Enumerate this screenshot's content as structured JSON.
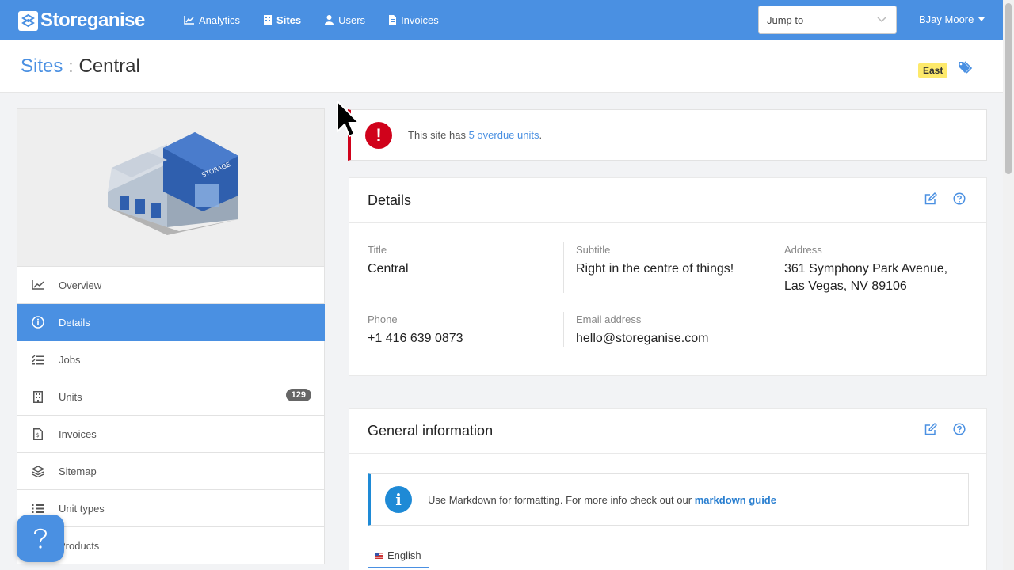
{
  "brand": {
    "name": "Storeganise"
  },
  "nav": {
    "items": [
      {
        "label": "Analytics",
        "icon": "chart-icon"
      },
      {
        "label": "Sites",
        "icon": "building-icon",
        "active": true
      },
      {
        "label": "Users",
        "icon": "user-icon"
      },
      {
        "label": "Invoices",
        "icon": "invoice-icon"
      }
    ],
    "jump_placeholder": "Jump to",
    "user_name": "BJay Moore"
  },
  "breadcrumb": {
    "parent": "Sites",
    "separator": ":",
    "current": "Central",
    "region_badge": "East"
  },
  "sidebar": {
    "items": [
      {
        "label": "Overview",
        "icon": "trend-icon"
      },
      {
        "label": "Details",
        "icon": "info-icon",
        "active": true
      },
      {
        "label": "Jobs",
        "icon": "checklist-icon"
      },
      {
        "label": "Units",
        "icon": "building-icon",
        "count": "129"
      },
      {
        "label": "Invoices",
        "icon": "invoice-icon"
      },
      {
        "label": "Sitemap",
        "icon": "layers-icon"
      },
      {
        "label": "Unit types",
        "icon": "list-icon"
      },
      {
        "label": "Products",
        "icon": "box-icon"
      }
    ]
  },
  "alert": {
    "prefix": "This site has ",
    "link": "5 overdue units",
    "suffix": "."
  },
  "details": {
    "title": "Details",
    "fields": {
      "title_label": "Title",
      "title_value": "Central",
      "subtitle_label": "Subtitle",
      "subtitle_value": "Right in the centre of things!",
      "address_label": "Address",
      "address_line1": "361 Symphony Park Avenue,",
      "address_line2": "Las Vegas, NV 89106",
      "phone_label": "Phone",
      "phone_value": "+1 416 639 0873",
      "email_label": "Email address",
      "email_value": "hello@storeganise.com"
    }
  },
  "general": {
    "title": "General information",
    "info_text": "Use Markdown for formatting.  For more info check out our ",
    "info_link": "markdown guide",
    "language": "English"
  },
  "colors": {
    "primary": "#4a90e2",
    "danger": "#d0021b",
    "info": "#1e8ad6",
    "badge": "#fde96b"
  }
}
